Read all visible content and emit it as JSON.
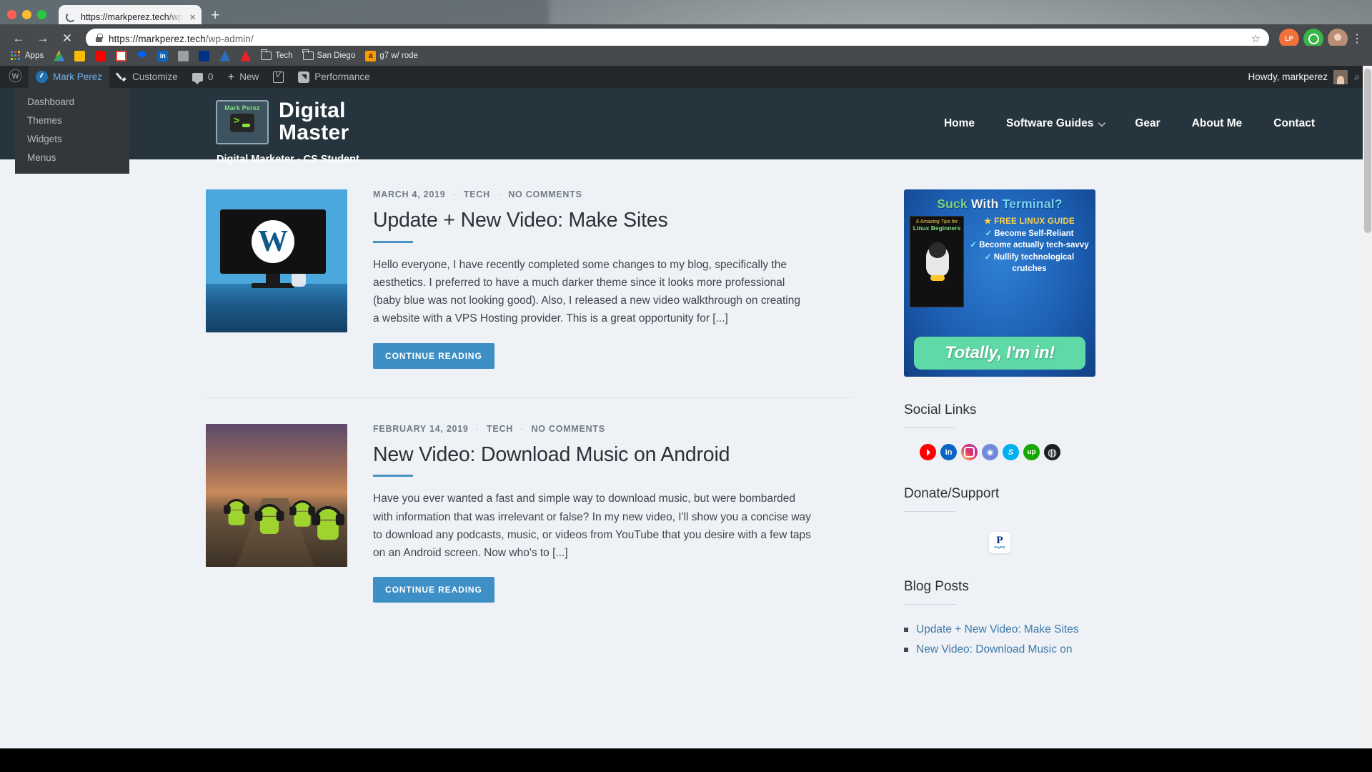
{
  "browser": {
    "tab": {
      "title": "https://markperez.tech/wp-ad",
      "close_label": "×",
      "loading_icon": "loading-spinner-icon"
    },
    "new_tab_label": "+",
    "nav": {
      "back": "←",
      "forward": "→",
      "stop": "✕"
    },
    "omnibox": {
      "url_prefix": "https://markperez.tech",
      "url_path": "/wp-admin/",
      "lock_icon": "lock-icon",
      "star_label": "☆"
    },
    "toolbar_icons": [
      "lastpass-icon",
      "grammarly-icon",
      "profile-avatar-icon",
      "chrome-menu-icon"
    ],
    "bookmarks": [
      {
        "label": "Apps",
        "icon": "apps-grid-icon"
      },
      {
        "label": "",
        "icon": "google-drive-icon"
      },
      {
        "label": "",
        "icon": "keep-notes-icon"
      },
      {
        "label": "",
        "icon": "youtube-icon"
      },
      {
        "label": "",
        "icon": "gmail-icon"
      },
      {
        "label": "",
        "icon": "dropbox-icon"
      },
      {
        "label": "",
        "icon": "linkedin-icon"
      },
      {
        "label": "",
        "icon": "monitor-icon"
      },
      {
        "label": "",
        "icon": "paypal-icon"
      },
      {
        "label": "",
        "icon": "atom-icon"
      },
      {
        "label": "",
        "icon": "adobe-icon"
      },
      {
        "label": "Tech",
        "icon": "folder-icon"
      },
      {
        "label": "San Diego",
        "icon": "folder-icon"
      },
      {
        "label": "g7 w/ rode",
        "icon": "amazon-icon"
      }
    ]
  },
  "wp_adminbar": {
    "logo_icon": "wordpress-logo-icon",
    "site_name": "Mark Perez",
    "customize_label": "Customize",
    "comments_count": "0",
    "new_label": "New",
    "performance_label": "Performance",
    "howdy": "Howdy, markperez",
    "search_icon": "search-icon",
    "dropdown": [
      {
        "label": "Dashboard"
      },
      {
        "label": "Themes"
      },
      {
        "label": "Widgets"
      },
      {
        "label": "Menus"
      }
    ]
  },
  "site": {
    "logo": {
      "name": "Mark Perez",
      "icon": "terminal-prompt-icon"
    },
    "brand_line1": "Digital",
    "brand_line2": "Master",
    "tagline": "Digital Marketer - CS Student",
    "nav": [
      {
        "label": "Home",
        "has_dropdown": false
      },
      {
        "label": "Software Guides",
        "has_dropdown": true
      },
      {
        "label": "Gear",
        "has_dropdown": false
      },
      {
        "label": "About Me",
        "has_dropdown": false
      },
      {
        "label": "Contact",
        "has_dropdown": false
      }
    ]
  },
  "posts": [
    {
      "date": "MARCH 4, 2019",
      "category": "TECH",
      "comments": "NO COMMENTS",
      "title": "Update + New Video: Make Sites",
      "excerpt": "Hello everyone, I have recently completed some changes to my blog, specifically the aesthetics. I preferred to have a much darker theme since it looks more professional (baby blue was not looking good). Also, I released a new video walkthrough on creating a website with a VPS Hosting provider. This is a great opportunity for [...]",
      "button": "CONTINUE READING",
      "thumb": "wordpress-monitor-image"
    },
    {
      "date": "FEBRUARY 14, 2019",
      "category": "TECH",
      "comments": "NO COMMENTS",
      "title": "New Video: Download Music on Android",
      "excerpt": "Have you ever wanted a fast and simple way to download music, but were bombarded with information that was irrelevant or false? In my new video, I'll show you a concise way to download any podcasts, music, or videos from YouTube that you desire with a few taps on an Android screen. Now who's to [...]",
      "button": "CONTINUE READING",
      "thumb": "android-robots-image"
    }
  ],
  "sidebar": {
    "ad": {
      "headline_w1": "Suck",
      "headline_w2": "With",
      "headline_w3": "Terminal?",
      "book_top": "6 Amazing Tips for",
      "book_title": "Linux Beginners",
      "free_line": "★ FREE LINUX GUIDE",
      "bullets": [
        {
          "check": "✓",
          "text": "Become Self-Reliant"
        },
        {
          "check": "✓",
          "text": "Become actually tech-savvy"
        },
        {
          "check": "✓",
          "text": "Nullify technological crutches"
        }
      ],
      "cta": "Totally, I'm in!"
    },
    "social_heading": "Social Links",
    "social_links": [
      {
        "name": "youtube-icon",
        "glyph": ""
      },
      {
        "name": "linkedin-icon",
        "glyph": "in"
      },
      {
        "name": "instagram-icon",
        "glyph": ""
      },
      {
        "name": "discord-icon",
        "glyph": "◉"
      },
      {
        "name": "skype-icon",
        "glyph": "S"
      },
      {
        "name": "upwork-icon",
        "glyph": "up"
      },
      {
        "name": "github-icon",
        "glyph": "◍"
      }
    ],
    "donate_heading": "Donate/Support",
    "paypal": {
      "mark": "P",
      "label": "PayPal"
    },
    "blog_heading": "Blog Posts",
    "blog_posts": [
      {
        "label": "Update + New Video: Make Sites"
      },
      {
        "label": "New Video: Download Music on"
      }
    ]
  },
  "colors": {
    "accent": "#3d8fc6",
    "header_bg": "#26353d",
    "admin_bg": "#23282d",
    "page_bg": "#eef1f5"
  }
}
